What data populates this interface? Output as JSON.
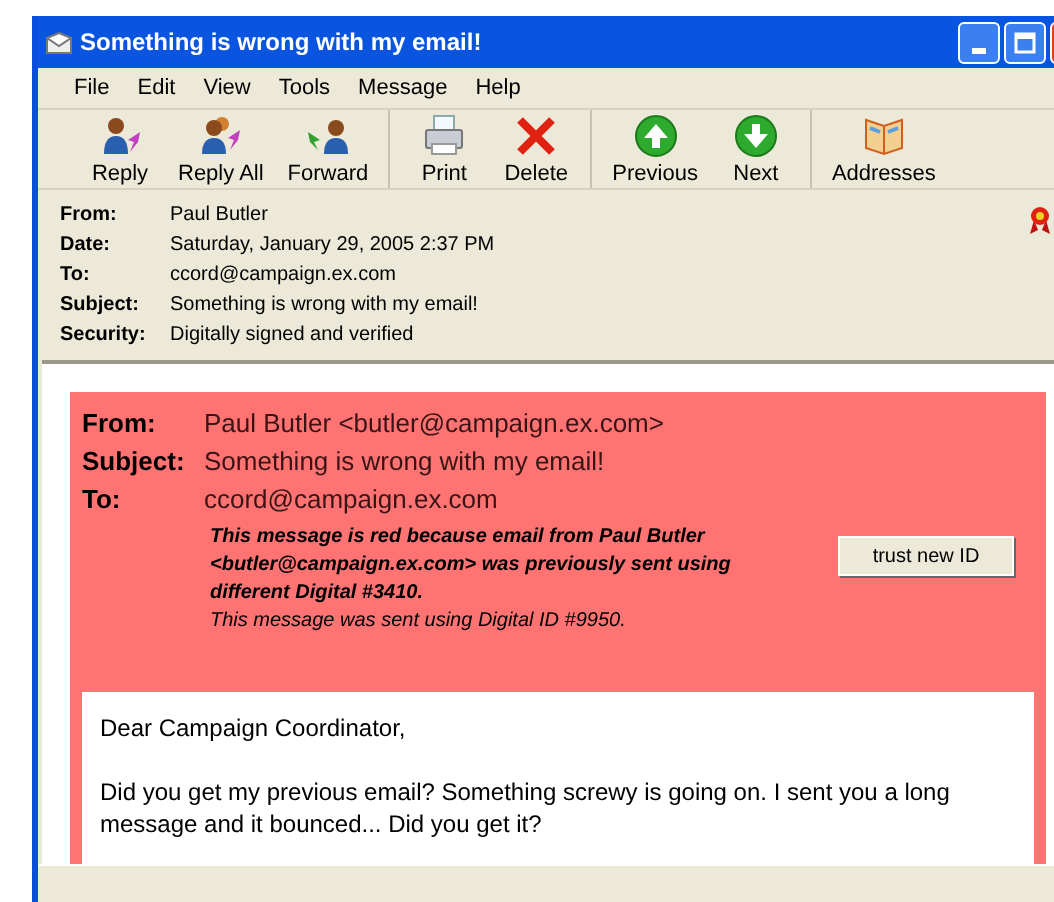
{
  "window": {
    "title": "Something is wrong with my email!"
  },
  "menu": [
    "File",
    "Edit",
    "View",
    "Tools",
    "Message",
    "Help"
  ],
  "toolbar": [
    {
      "kind": "reply",
      "label": "Reply"
    },
    {
      "kind": "reply_all",
      "label": "Reply All"
    },
    {
      "kind": "forward",
      "label": "Forward"
    },
    {
      "kind": "print",
      "label": "Print"
    },
    {
      "kind": "delete",
      "label": "Delete"
    },
    {
      "kind": "previous",
      "label": "Previous"
    },
    {
      "kind": "next",
      "label": "Next"
    },
    {
      "kind": "addresses",
      "label": "Addresses"
    }
  ],
  "header": [
    {
      "label": "From:",
      "value": "Paul Butler"
    },
    {
      "label": "Date:",
      "value": "Saturday, January 29, 2005 2:37 PM"
    },
    {
      "label": "To:",
      "value": "ccord@campaign.ex.com"
    },
    {
      "label": "Subject:",
      "value": "Something is wrong with my email!"
    },
    {
      "label": "Security:",
      "value": "Digitally signed and verified"
    }
  ],
  "warning_panel": {
    "fields": [
      {
        "label": "From:",
        "value": "Paul Butler <butler@campaign.ex.com>"
      },
      {
        "label": "Subject:",
        "value": "Something is wrong with my email!"
      },
      {
        "label": "To:",
        "value": "ccord@campaign.ex.com"
      }
    ],
    "warning": "This message is red because email from Paul Butler <butler@campaign.ex.com> was previously sent using different Digital #3410.",
    "note": "This message was sent using Digital ID #9950.",
    "button": "trust new ID"
  },
  "message_body": [
    "Dear Campaign Coordinator,",
    "Did you get my previous email? Something screwy is going on. I sent you a long message and it bounced... Did you get it?"
  ]
}
